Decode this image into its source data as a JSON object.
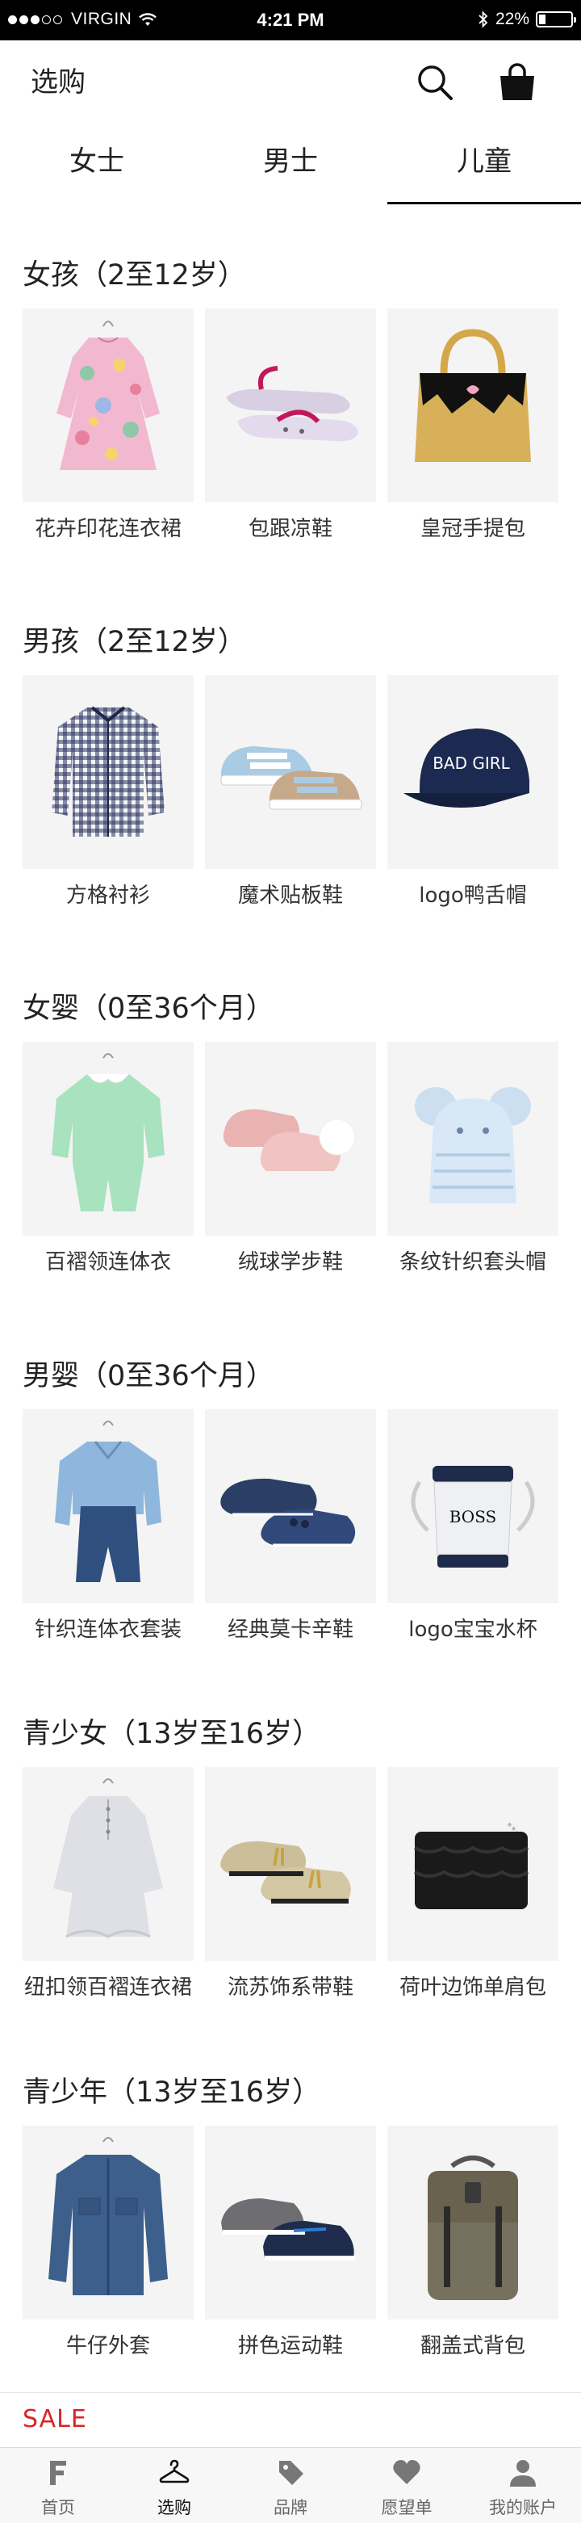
{
  "status_bar": {
    "carrier": "VIRGIN",
    "time": "4:21 PM",
    "battery_text": "22%",
    "battery_level": 0.22
  },
  "header": {
    "title": "选购"
  },
  "tabs": [
    {
      "label": "女士"
    },
    {
      "label": "男士"
    },
    {
      "label": "儿童"
    }
  ],
  "sections": [
    {
      "title": "女孩（2至12岁）",
      "products": [
        {
          "label": "花卉印花连衣裙"
        },
        {
          "label": "包跟凉鞋"
        },
        {
          "label": "皇冠手提包"
        }
      ]
    },
    {
      "title": "男孩（2至12岁）",
      "products": [
        {
          "label": "方格衬衫"
        },
        {
          "label": "魔术贴板鞋"
        },
        {
          "label": "logo鸭舌帽"
        }
      ]
    },
    {
      "title": "女婴（0至36个月）",
      "products": [
        {
          "label": "百褶领连体衣"
        },
        {
          "label": "绒球学步鞋"
        },
        {
          "label": "条纹针织套头帽"
        }
      ]
    },
    {
      "title": "男婴（0至36个月）",
      "products": [
        {
          "label": "针织连体衣套装"
        },
        {
          "label": "经典莫卡辛鞋"
        },
        {
          "label": "logo宝宝水杯"
        }
      ]
    },
    {
      "title": "青少女（13岁至16岁）",
      "products": [
        {
          "label": "纽扣领百褶连衣裙"
        },
        {
          "label": "流苏饰系带鞋"
        },
        {
          "label": "荷叶边饰单肩包"
        }
      ]
    },
    {
      "title": "青少年（13岁至16岁）",
      "products": [
        {
          "label": "牛仔外套"
        },
        {
          "label": "拼色运动鞋"
        },
        {
          "label": "翻盖式背包"
        }
      ]
    }
  ],
  "product_image_text": {
    "cap_text": "BAD GIRL",
    "cup_brand": "BOSS"
  },
  "sale": {
    "label": "SALE"
  },
  "bottom_nav": [
    {
      "label": "首页"
    },
    {
      "label": "选购"
    },
    {
      "label": "品牌"
    },
    {
      "label": "愿望单"
    },
    {
      "label": "我的账户"
    }
  ],
  "colors": {
    "accent_sale": "#d9252a",
    "tile_background": "#f4f4f4",
    "status_bar": "#000000"
  }
}
